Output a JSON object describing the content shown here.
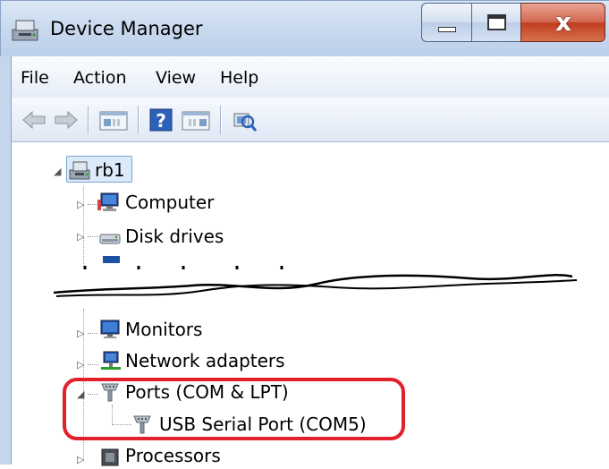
{
  "window": {
    "title": "Device Manager",
    "buttons": {
      "minimize_icon": "minimize-icon",
      "maximize_icon": "maximize-icon",
      "close_glyph": "x"
    }
  },
  "menu": [
    "File",
    "Action",
    "View",
    "Help"
  ],
  "toolbar": [
    "back-arrow-icon",
    "forward-arrow-icon",
    "show-hide-console-tree-icon",
    "help-icon",
    "show-action-pane-icon",
    "scan-hardware-changes-icon"
  ],
  "tree": {
    "root": "rb1",
    "items": [
      {
        "label": "Computer",
        "icon": "computer-icon"
      },
      {
        "label": "Disk drives",
        "icon": "disk-drive-icon"
      },
      {
        "label": "Monitors",
        "icon": "monitor-icon"
      },
      {
        "label": "Network adapters",
        "icon": "network-adapter-icon"
      },
      {
        "label": "Ports (COM & LPT)",
        "icon": "port-icon"
      },
      {
        "label": "USB Serial Port (COM5)",
        "icon": "port-icon"
      },
      {
        "label": "Processors",
        "icon": "processor-icon"
      }
    ]
  },
  "colors": {
    "highlight": "#e2202b",
    "close_button": "#c23d1f",
    "frame": "#c7d8ee"
  }
}
